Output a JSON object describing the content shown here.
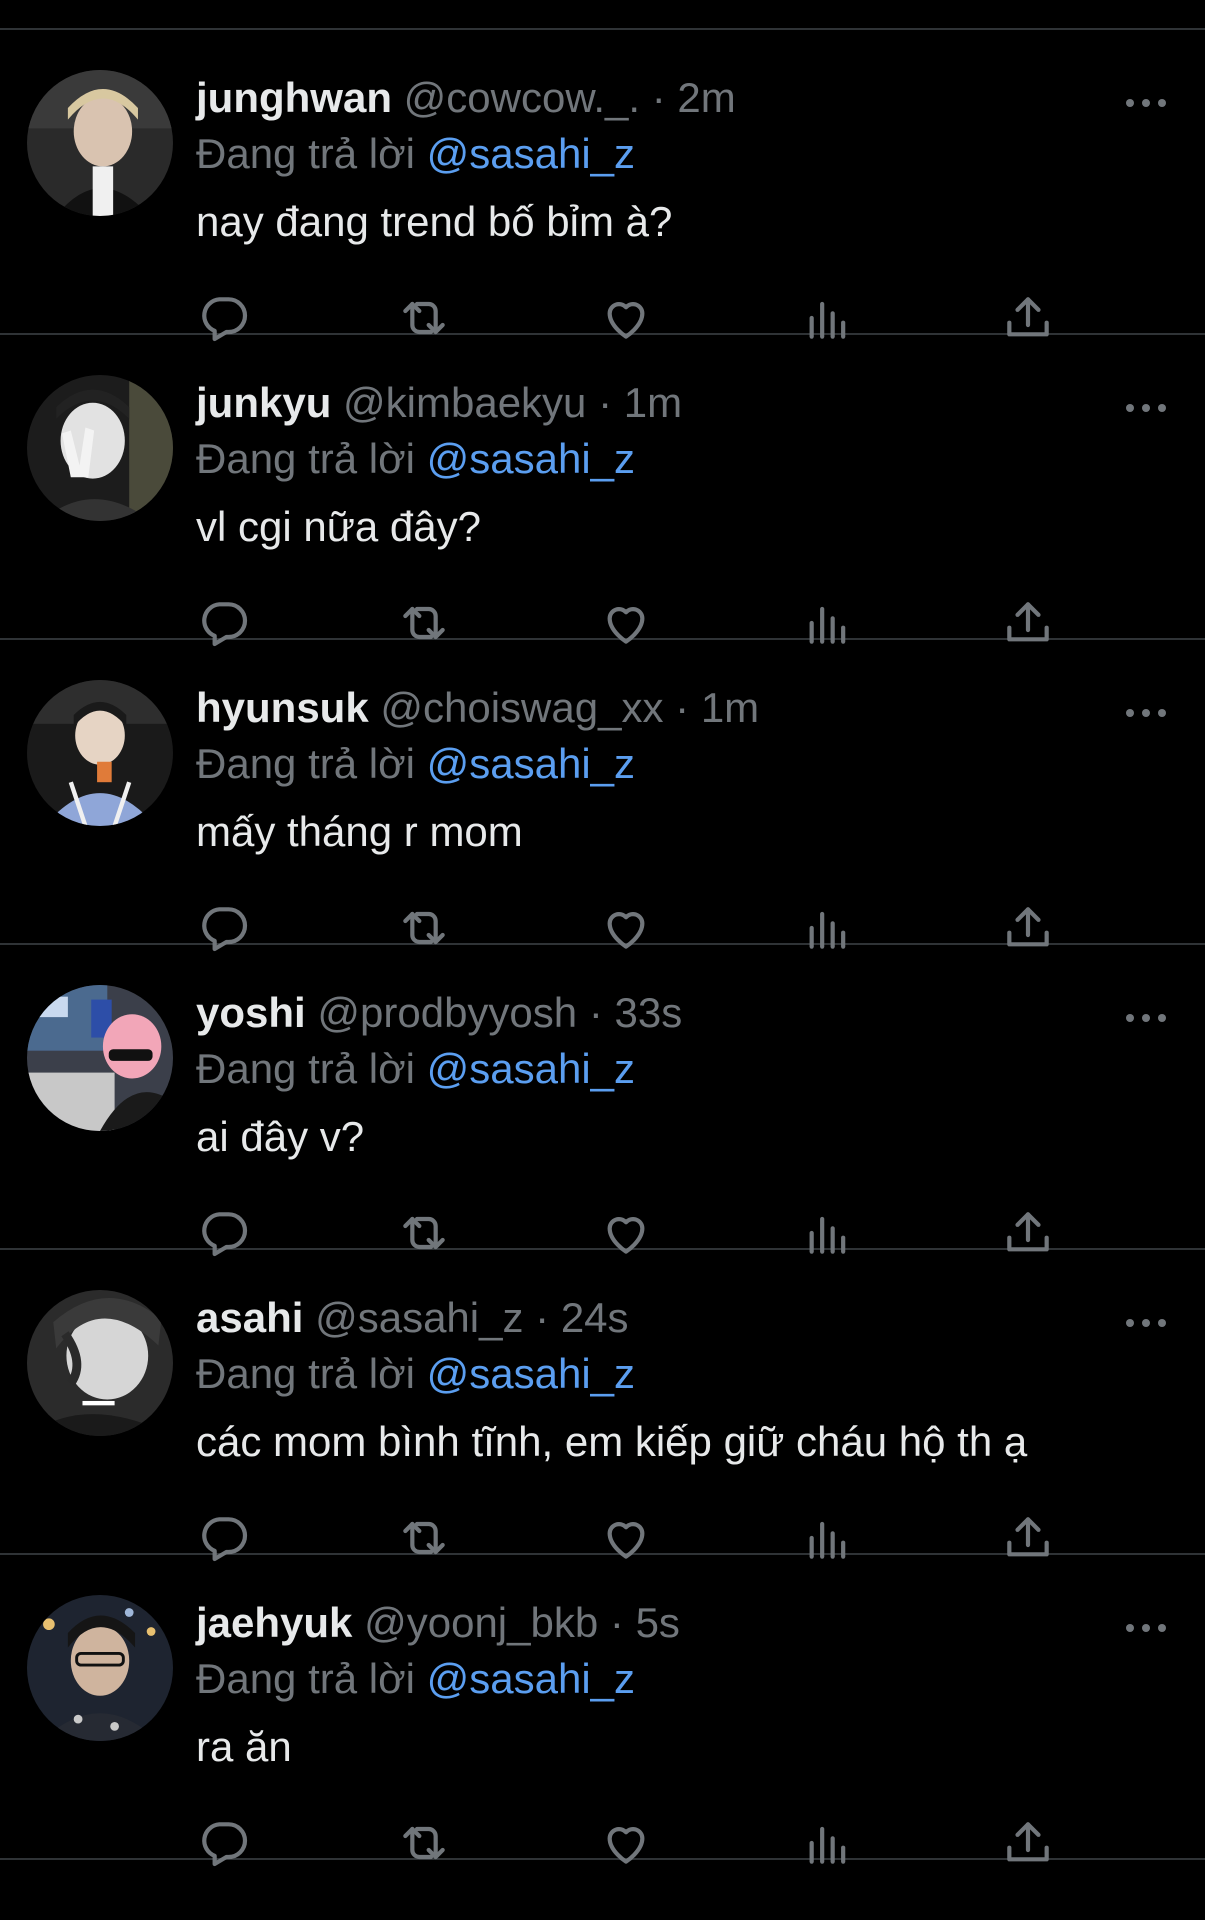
{
  "colors": {
    "background": "#000000",
    "divider": "#2f3336",
    "text_primary": "#e7e9ea",
    "text_secondary": "#71767b",
    "mention": "#5b9ef0"
  },
  "icons": {
    "more": "more-horizontal-icon",
    "reply": "reply-bubble-icon",
    "retweet": "retweet-icon",
    "like": "heart-icon",
    "views": "views-bar-chart-icon",
    "share": "share-upload-icon"
  },
  "tweets": [
    {
      "display_name": "junghwan",
      "handle": "@cowcow._.",
      "dot": "·",
      "time": "2m",
      "reply_prefix": "Đang trả lời",
      "reply_to": "@sasahi_z",
      "text": "nay đang trend bố bỉm à?"
    },
    {
      "display_name": "junkyu",
      "handle": "@kimbaekyu",
      "dot": "·",
      "time": "1m",
      "reply_prefix": "Đang trả lời",
      "reply_to": "@sasahi_z",
      "text": "vl cgi nữa đây?"
    },
    {
      "display_name": "hyunsuk",
      "handle": "@choiswag_xx",
      "dot": "·",
      "time": "1m",
      "reply_prefix": "Đang trả lời",
      "reply_to": "@sasahi_z",
      "text": "mấy tháng r mom"
    },
    {
      "display_name": "yoshi",
      "handle": "@prodbyyosh",
      "dot": "·",
      "time": "33s",
      "reply_prefix": "Đang trả lời",
      "reply_to": "@sasahi_z",
      "text": "ai đây v?"
    },
    {
      "display_name": "asahi",
      "handle": "@sasahi_z",
      "dot": "·",
      "time": "24s",
      "reply_prefix": "Đang trả lời",
      "reply_to": "@sasahi_z",
      "text": "các mom bình tĩnh, em kiếp giữ cháu hộ th ạ"
    },
    {
      "display_name": "jaehyuk",
      "handle": "@yoonj_bkb",
      "dot": "·",
      "time": "5s",
      "reply_prefix": "Đang trả lời",
      "reply_to": "@sasahi_z",
      "text": "ra ăn"
    }
  ]
}
